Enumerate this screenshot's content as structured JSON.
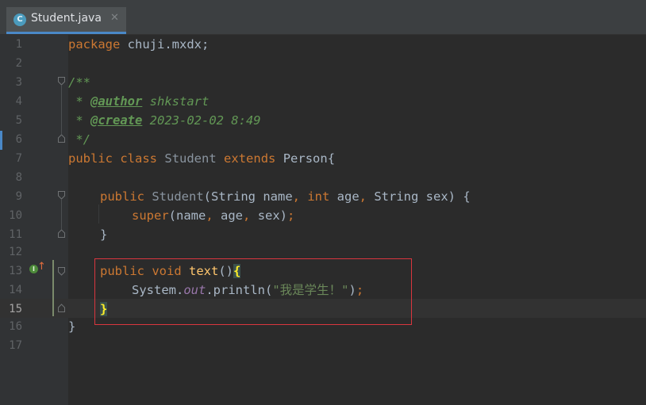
{
  "tab": {
    "label": "Student.java",
    "icon_letter": "C",
    "close": "✕"
  },
  "line_numbers": [
    "1",
    "2",
    "3",
    "4",
    "5",
    "6",
    "7",
    "8",
    "9",
    "10",
    "11",
    "12",
    "13",
    "14",
    "15",
    "16",
    "17"
  ],
  "current_line": "15",
  "code": {
    "l1": {
      "kw": "package",
      "rest": " chuji.mxdx;"
    },
    "l3": {
      "text": "/**"
    },
    "l4": {
      "star": " * ",
      "tag": "@author",
      "val": " shkstart"
    },
    "l5": {
      "star": " * ",
      "tag": "@create",
      "val": " 2023-02-02 8:49"
    },
    "l6": {
      "text": " */"
    },
    "l7": {
      "kw1": "public",
      "kw2": "class",
      "cls": "Student",
      "kw3": "extends",
      "rest": "Person{"
    },
    "l9": {
      "kw": "public",
      "name": "Student",
      "p1": "(String name",
      "c1": ",",
      "kw2": "int",
      "p2": " age",
      "c2": ",",
      "p3": " String sex) {"
    },
    "l10": {
      "kw": "super",
      "p1": "(name",
      "c1": ",",
      "p2": " age",
      "c2": ",",
      "p3": " sex)",
      "semi": ";"
    },
    "l11": {
      "text": "}"
    },
    "l13": {
      "kw1": "public",
      "kw2": "void",
      "name": "text",
      "paren": "()",
      "brace": "{"
    },
    "l14": {
      "obj": "System.",
      "field": "out",
      "call": ".println(",
      "str": "\"我是学生！\"",
      "close": ")",
      "semi": ";"
    },
    "l15": {
      "brace": "}"
    },
    "l16": {
      "text": "}"
    }
  },
  "colors": {
    "background": "#2b2b2b",
    "gutter": "#313335",
    "keyword": "#cc7832",
    "method": "#ffc66d",
    "string": "#6a8759",
    "comment": "#629755",
    "highlight_box": "#d9363e"
  }
}
